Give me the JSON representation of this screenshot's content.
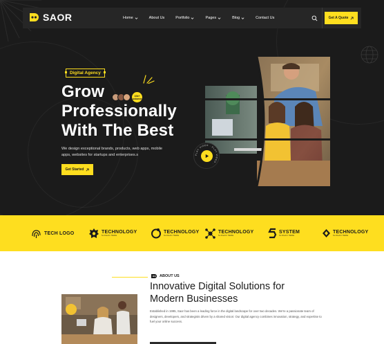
{
  "brand": {
    "name": "SAOR"
  },
  "nav": {
    "items": [
      {
        "label": "Home",
        "dropdown": true
      },
      {
        "label": "About Us",
        "dropdown": false
      },
      {
        "label": "Portfolio",
        "dropdown": true
      },
      {
        "label": "Pages",
        "dropdown": true
      },
      {
        "label": "Blog",
        "dropdown": true
      },
      {
        "label": "Contact Us",
        "dropdown": false
      }
    ],
    "quote_label": "Get A Quote"
  },
  "hero": {
    "badge": "Digital Agency",
    "headline_line1": "Grow",
    "headline_line2": "Professionally",
    "headline_line3": "With The Best",
    "avatar_badge": "10k+ Customers",
    "description": "We design exceptional brands, products, web apps, mobile apps, websites for startups and enterprises.s",
    "cta_label": "Get Started",
    "play_ring_text": "PLAY VIDEO · PLAY VIDEO ·"
  },
  "logos": [
    {
      "name": "TECH LOGO",
      "tag": ""
    },
    {
      "name": "TECHNOLOGY",
      "tag": "SLOGAN HERE"
    },
    {
      "name": "TECHNOLOGY",
      "tag": "SLOGAN HERE"
    },
    {
      "name": "TECHNOLOGY",
      "tag": "SLOGAN HERE"
    },
    {
      "name": "SYSTEM",
      "tag": "SLOGAN HERE"
    },
    {
      "name": "TECHNOLOGY",
      "tag": "SLOGAN HERE"
    }
  ],
  "about": {
    "label": "ABOUT US",
    "title_line1": "Innovative Digital Solutions for",
    "title_line2": "Modern Businesses",
    "text": "Established in 1995, Saor has been a leading force in the digital landscape for over two decades. We're a passionate team of designers, developers, and strategists driven by a shared vision: Our digital agency combines innovation, strategy, and expertise to fuel your online success."
  },
  "colors": {
    "accent": "#fede1f",
    "dark": "#1b1b1b",
    "nav_bg": "#262626"
  }
}
